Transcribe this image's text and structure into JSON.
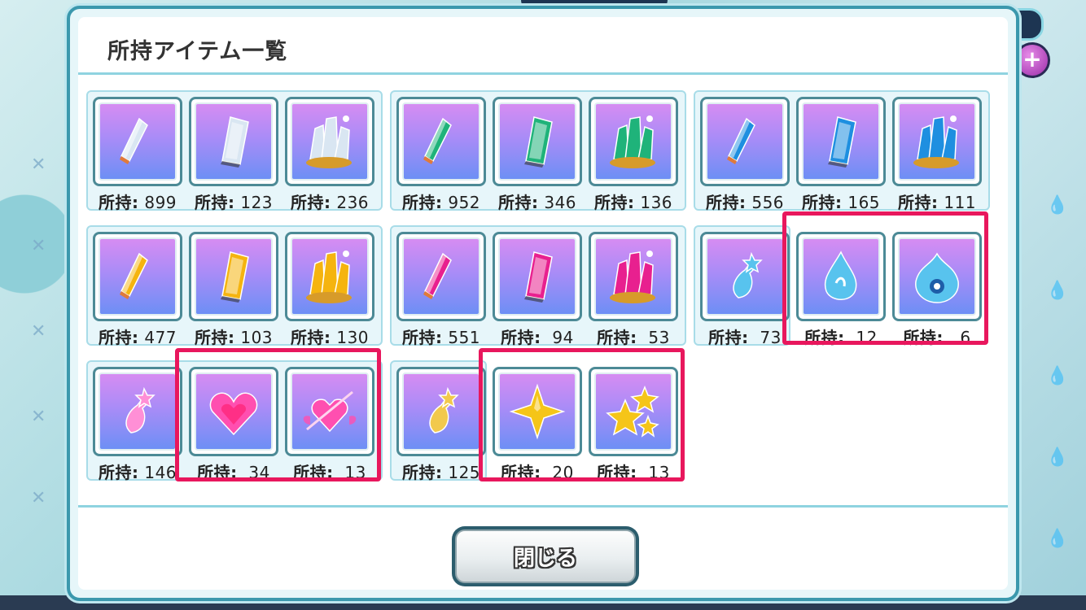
{
  "dialog": {
    "title": "所持アイテム一覧",
    "close_label": "閉じる"
  },
  "count_prefix": "所持:",
  "groups": [
    {
      "items": [
        {
          "name": "crystal-clear-small-icon",
          "color": "#d9e6f2",
          "count": "899"
        },
        {
          "name": "crystal-clear-medium-icon",
          "color": "#d9e6f2",
          "count": "123"
        },
        {
          "name": "crystal-clear-large-icon",
          "color": "#d9e6f2",
          "count": "236"
        }
      ]
    },
    {
      "items": [
        {
          "name": "crystal-green-small-icon",
          "color": "#1fb37a",
          "count": "952"
        },
        {
          "name": "crystal-green-medium-icon",
          "color": "#1fb37a",
          "count": "346"
        },
        {
          "name": "crystal-green-large-icon",
          "color": "#1fb37a",
          "count": "136"
        }
      ]
    },
    {
      "items": [
        {
          "name": "crystal-blue-small-icon",
          "color": "#1e8fe0",
          "count": "556"
        },
        {
          "name": "crystal-blue-medium-icon",
          "color": "#1e8fe0",
          "count": "165"
        },
        {
          "name": "crystal-blue-large-icon",
          "color": "#1e8fe0",
          "count": "111"
        }
      ]
    },
    {
      "items": [
        {
          "name": "crystal-gold-small-icon",
          "color": "#f5b40f",
          "count": "477"
        },
        {
          "name": "crystal-gold-medium-icon",
          "color": "#f5b40f",
          "count": "103"
        },
        {
          "name": "crystal-gold-large-icon",
          "color": "#f5b40f",
          "count": "130"
        }
      ]
    },
    {
      "items": [
        {
          "name": "crystal-pink-small-icon",
          "color": "#e8208f",
          "count": "551"
        },
        {
          "name": "crystal-pink-medium-icon",
          "color": "#e8208f",
          "count": " 94"
        },
        {
          "name": "crystal-pink-large-icon",
          "color": "#e8208f",
          "count": " 53"
        }
      ]
    },
    {
      "items": [
        {
          "name": "vial-blue-icon",
          "color": "#58c3ee",
          "count": " 73"
        },
        {
          "name": "water-drop-icon",
          "color": "#58c3ee",
          "count": " 12"
        },
        {
          "name": "water-flame-icon",
          "color": "#58c3ee",
          "count": "  6"
        }
      ]
    },
    {
      "items": [
        {
          "name": "vial-heart-icon",
          "color": "#ff8fd6",
          "count": "146"
        },
        {
          "name": "heart-gem-icon",
          "color": "#ff4fb0",
          "count": " 34"
        },
        {
          "name": "winged-heart-icon",
          "color": "#ff4fb0",
          "count": " 13"
        }
      ]
    },
    {
      "items": [
        {
          "name": "vial-star-icon",
          "color": "#f2c94c",
          "count": "125"
        },
        {
          "name": "star-single-icon",
          "color": "#f5c518",
          "count": " 20"
        },
        {
          "name": "star-cluster-icon",
          "color": "#f5c518",
          "count": " 13"
        }
      ]
    }
  ],
  "colors": {
    "highlight": "#e8175d",
    "dialog_border": "#3b98ad"
  }
}
